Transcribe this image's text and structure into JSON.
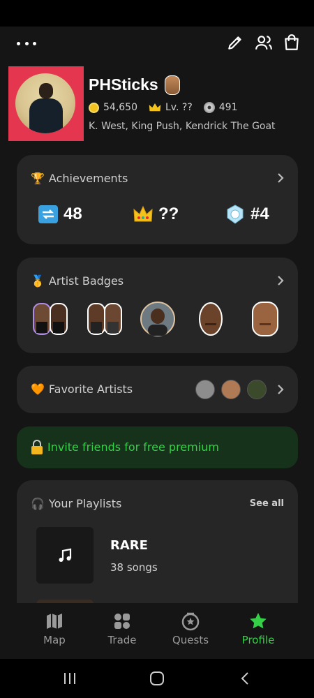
{
  "profile": {
    "username": "PHSticks",
    "coins": "54,650",
    "level": "Lv. ??",
    "discs": "491",
    "favorites_line": "K. West, King Push, Kendrick The Goat"
  },
  "achievements": {
    "title": "Achievements",
    "items": [
      {
        "icon": "repeat-icon",
        "value": "48"
      },
      {
        "icon": "crown-icon",
        "value": "??"
      },
      {
        "icon": "medal-icon",
        "value": "#4"
      }
    ]
  },
  "artist_badges": {
    "title": "Artist Badges"
  },
  "favorite_artists": {
    "title": "Favorite Artists"
  },
  "invite": {
    "text": "Invite friends for free premium"
  },
  "playlists": {
    "title": "Your Playlists",
    "see_all": "See all",
    "items": [
      {
        "name": "RARE",
        "count": "38 songs"
      }
    ]
  },
  "bottom_nav": {
    "items": [
      {
        "label": "Map",
        "icon": "map-icon"
      },
      {
        "label": "Trade",
        "icon": "trade-icon"
      },
      {
        "label": "Quests",
        "icon": "quests-icon"
      },
      {
        "label": "Profile",
        "icon": "star-icon"
      }
    ],
    "active": "Profile"
  },
  "colors": {
    "accent_green": "#35d048",
    "avatar_bg": "#e5364f",
    "card_bg": "#262626",
    "invite_bg": "#17321a"
  }
}
